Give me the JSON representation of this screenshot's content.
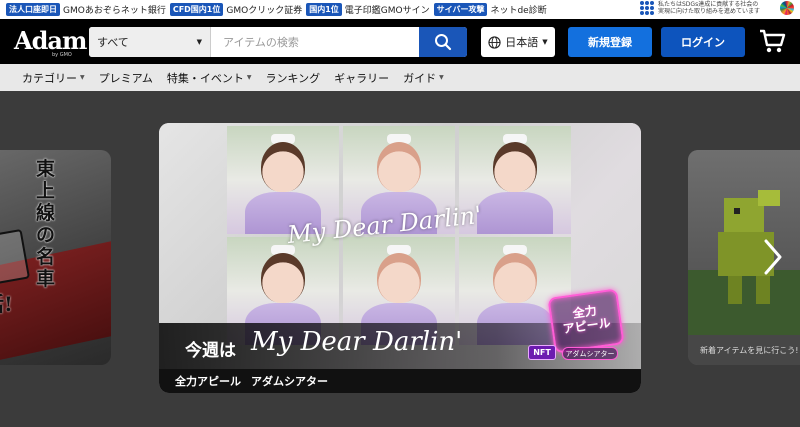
{
  "promos": [
    {
      "tag": "法人口座即日",
      "text": "GMOあおぞらネット銀行"
    },
    {
      "tag": "CFD国内1位",
      "text": "GMOクリック証券"
    },
    {
      "tag": "国内1位",
      "text": "電子印鑑GMOサイン"
    },
    {
      "tag": "サイバー攻撃",
      "text": "ネットde診断"
    }
  ],
  "sdgs": {
    "line1": "私たちはSDGs達成に貢献する社会の",
    "line2": "実現に向けた取り組みを進めています"
  },
  "header": {
    "logo": "Adam",
    "logo_sub": "by GMO",
    "search_category": "すべて",
    "search_placeholder": "アイテムの検索",
    "language": "日本語",
    "register_label": "新規登録",
    "login_label": "ログイン"
  },
  "nav": [
    {
      "label": "カテゴリー",
      "dropdown": true
    },
    {
      "label": "プレミアム",
      "dropdown": false
    },
    {
      "label": "特集・イベント",
      "dropdown": true
    },
    {
      "label": "ランキング",
      "dropdown": false
    },
    {
      "label": "ギャラリー",
      "dropdown": false
    },
    {
      "label": "ガイド",
      "dropdown": true
    }
  ],
  "carousel": {
    "left": {
      "vertical_text": "東上線の名車",
      "bottom_text": "活!"
    },
    "main": {
      "banner_script": "My Dear Darlin'",
      "caption_prefix": "今週は",
      "caption_name": "My Dear Darlin'",
      "nft_badge": "NFT",
      "neon_line1": "全力",
      "neon_line2": "アピール",
      "neon_sub": "アダムシアター",
      "footer_left": "全力アピール",
      "footer_right": "アダムシアター"
    },
    "right": {
      "caption": "新着アイテムを見に行こう!"
    }
  },
  "colors": {
    "brand_blue": "#1a56b8",
    "header_bg": "#000000",
    "nav_bg": "#e8e8e8"
  }
}
